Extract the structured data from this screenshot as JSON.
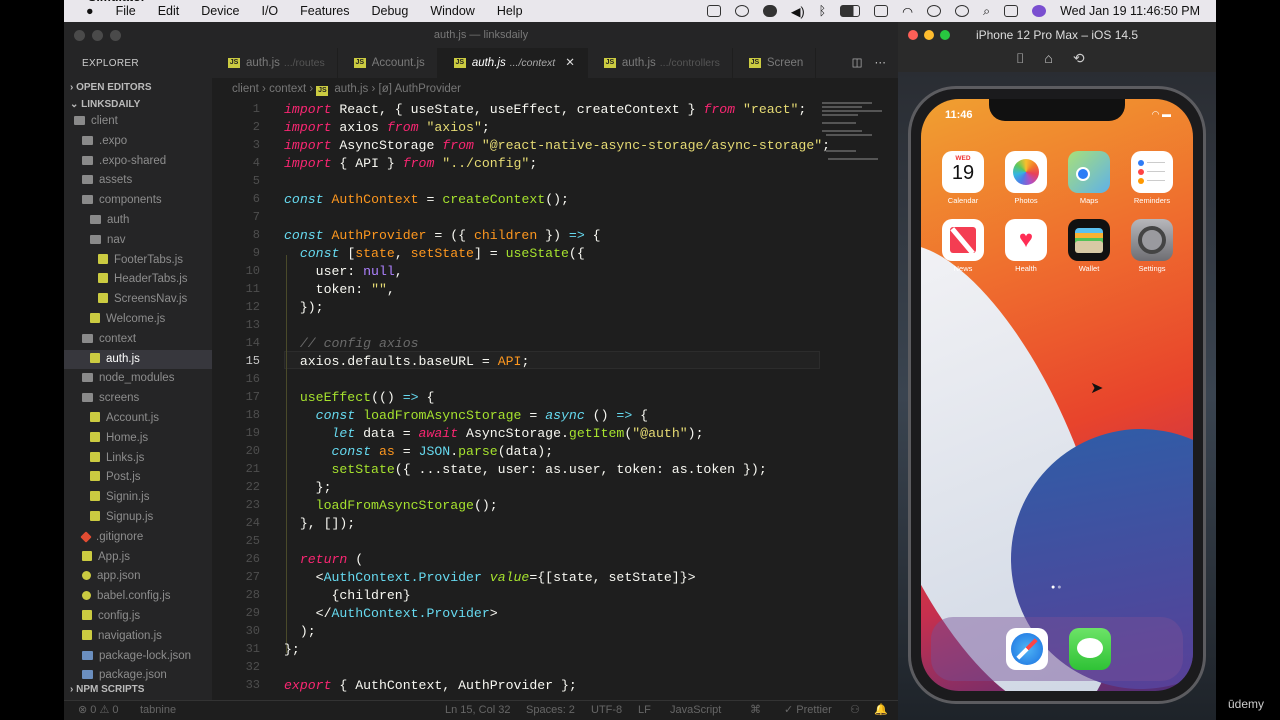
{
  "menubar": {
    "app_name": "Simulator",
    "menus": [
      "File",
      "Edit",
      "Device",
      "I/O",
      "Features",
      "Debug",
      "Window",
      "Help"
    ],
    "clock": "Wed Jan 19  11:46:50 PM"
  },
  "vscode": {
    "window_title": "auth.js — linksdaily",
    "explorer_title": "EXPLORER",
    "open_editors": "OPEN EDITORS",
    "project": "LINKSDAILY",
    "npm_scripts": "NPM SCRIPTS",
    "tree": [
      {
        "name": "client",
        "kind": "folder",
        "depth": 0
      },
      {
        "name": ".expo",
        "kind": "folder",
        "depth": 1
      },
      {
        "name": ".expo-shared",
        "kind": "folder",
        "depth": 1
      },
      {
        "name": "assets",
        "kind": "folder",
        "depth": 1
      },
      {
        "name": "components",
        "kind": "folder",
        "depth": 1
      },
      {
        "name": "auth",
        "kind": "folder",
        "depth": 2
      },
      {
        "name": "nav",
        "kind": "folder",
        "depth": 2
      },
      {
        "name": "FooterTabs.js",
        "kind": "js",
        "depth": 3
      },
      {
        "name": "HeaderTabs.js",
        "kind": "js",
        "depth": 3
      },
      {
        "name": "ScreensNav.js",
        "kind": "js",
        "depth": 3
      },
      {
        "name": "Welcome.js",
        "kind": "js",
        "depth": 2
      },
      {
        "name": "context",
        "kind": "folder",
        "depth": 1
      },
      {
        "name": "auth.js",
        "kind": "js",
        "depth": 2,
        "active": true
      },
      {
        "name": "node_modules",
        "kind": "folder",
        "depth": 1
      },
      {
        "name": "screens",
        "kind": "folder",
        "depth": 1
      },
      {
        "name": "Account.js",
        "kind": "js",
        "depth": 2
      },
      {
        "name": "Home.js",
        "kind": "js",
        "depth": 2
      },
      {
        "name": "Links.js",
        "kind": "js",
        "depth": 2
      },
      {
        "name": "Post.js",
        "kind": "js",
        "depth": 2
      },
      {
        "name": "Signin.js",
        "kind": "js",
        "depth": 2
      },
      {
        "name": "Signup.js",
        "kind": "js",
        "depth": 2
      },
      {
        "name": ".gitignore",
        "kind": "git",
        "depth": 1
      },
      {
        "name": "App.js",
        "kind": "js",
        "depth": 1
      },
      {
        "name": "app.json",
        "kind": "json",
        "depth": 1
      },
      {
        "name": "babel.config.js",
        "kind": "json",
        "depth": 1
      },
      {
        "name": "config.js",
        "kind": "js",
        "depth": 1
      },
      {
        "name": "navigation.js",
        "kind": "js",
        "depth": 1
      },
      {
        "name": "package-lock.json",
        "kind": "doc",
        "depth": 1
      },
      {
        "name": "package.json",
        "kind": "doc",
        "depth": 1
      }
    ],
    "tabs": [
      {
        "name": "auth.js",
        "dir": ".../routes"
      },
      {
        "name": "Account.js",
        "dir": ""
      },
      {
        "name": "auth.js",
        "dir": ".../context",
        "active": true
      },
      {
        "name": "auth.js",
        "dir": ".../controllers"
      },
      {
        "name": "Screen",
        "dir": ""
      }
    ],
    "breadcrumb": [
      "client",
      "context",
      "auth.js",
      "AuthProvider"
    ],
    "current_line": 15,
    "status": {
      "problems": "⊗ 0  ⚠ 0",
      "tabnine": "tabnine",
      "position": "Ln 15, Col 32",
      "spaces": "Spaces: 2",
      "encoding": "UTF-8",
      "eol": "LF",
      "language": "JavaScript",
      "formatter": "✓ Prettier"
    }
  },
  "simulator": {
    "title": "iPhone 12 Pro Max – iOS 14.5",
    "status_time": "11:46",
    "apps": [
      {
        "label": "Calendar",
        "color": "#ffffff"
      },
      {
        "label": "Photos",
        "color": "#ffffff"
      },
      {
        "label": "Maps",
        "color": "#7cc46a"
      },
      {
        "label": "Reminders",
        "color": "#ffffff"
      },
      {
        "label": "News",
        "color": "#f0f0f0"
      },
      {
        "label": "Health",
        "color": "#ffffff"
      },
      {
        "label": "Wallet",
        "color": "#111111"
      },
      {
        "label": "Settings",
        "color": "#8e8e93"
      }
    ],
    "calendar_day": "WED",
    "calendar_date": "19"
  },
  "watermark": "ūdemy"
}
